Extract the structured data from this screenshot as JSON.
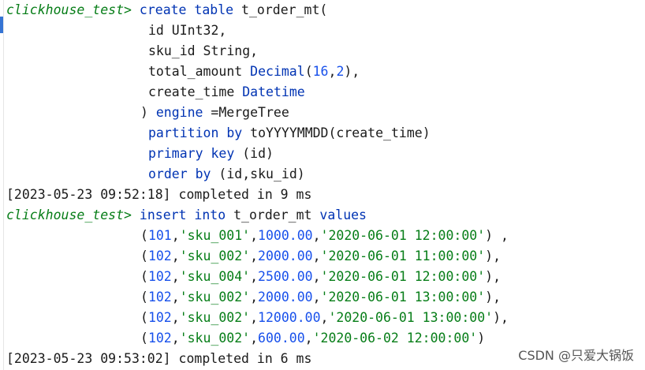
{
  "prompt": "clickhouse_test>",
  "create_table": {
    "line1": {
      "kw": "create table",
      "rest": " t_order_mt("
    },
    "col_id": "id UInt32,",
    "col_sku": "sku_id String,",
    "col_amount": {
      "name": "total_amount ",
      "type": "Decimal",
      "open": "(",
      "p": "16",
      "comma": ",",
      "s": "2",
      "close": "),"
    },
    "col_time": {
      "name": "create_time ",
      "type": "Datetime"
    },
    "engine": {
      "open": ") ",
      "kw": "engine",
      "rest": " =MergeTree"
    },
    "partition": {
      "kw": "partition by",
      "rest": " toYYYYMMDD(create_time)"
    },
    "primary": {
      "kw": "primary key",
      "rest": " (id)"
    },
    "order": {
      "kw": "order by",
      "rest": " (id,sku_id)"
    }
  },
  "status1": "[2023-05-23 09:52:18] completed in 9 ms",
  "insert": {
    "kw1": "insert into",
    "table": " t_order_mt ",
    "kw2": "values"
  },
  "rows": [
    {
      "id": "101",
      "sku": "'sku_001'",
      "amount": "1000.00",
      "time": "'2020-06-01 12:00:00'",
      "tail": ") ,"
    },
    {
      "id": "102",
      "sku": "'sku_002'",
      "amount": "2000.00",
      "time": "'2020-06-01 11:00:00'",
      "tail": "),"
    },
    {
      "id": "102",
      "sku": "'sku_004'",
      "amount": "2500.00",
      "time": "'2020-06-01 12:00:00'",
      "tail": "),"
    },
    {
      "id": "102",
      "sku": "'sku_002'",
      "amount": "2000.00",
      "time": "'2020-06-01 13:00:00'",
      "tail": "),"
    },
    {
      "id": "102",
      "sku": "'sku_002'",
      "amount": "12000.00",
      "time": "'2020-06-01 13:00:00'",
      "tail": "),"
    },
    {
      "id": "102",
      "sku": "'sku_002'",
      "amount": "600.00",
      "time": "'2020-06-02 12:00:00'",
      "tail": ")"
    }
  ],
  "status2": "[2023-05-23 09:53:02] completed in 6 ms",
  "watermark": "CSDN @只爱大锅饭",
  "colors": {
    "prompt": "#067d17",
    "keyword": "#0033b3",
    "number": "#1750eb",
    "string": "#067d17",
    "marker": "#3574d4"
  }
}
